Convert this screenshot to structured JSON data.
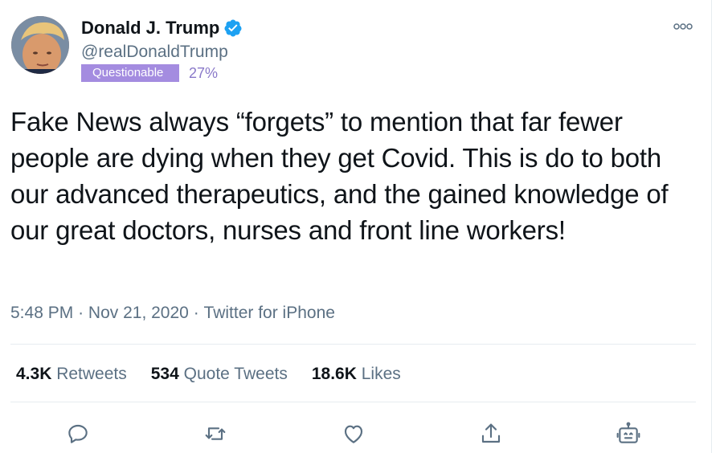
{
  "user": {
    "display_name": "Donald J. Trump",
    "handle": "@realDonaldTrump",
    "verified": true
  },
  "rating": {
    "label": "Questionable",
    "percent": "27%"
  },
  "tweet": {
    "text": "Fake News always “forgets” to mention that far fewer people are dying when they get Covid. This is do to both our advanced therapeutics, and the gained knowledge of our great doctors, nurses and front line workers!",
    "time": "5:48 PM",
    "date": "Nov 21, 2020",
    "source": "Twitter for iPhone",
    "dot": "·"
  },
  "stats": {
    "retweets_count": "4.3K",
    "retweets_label": "Retweets",
    "quotes_count": "534",
    "quotes_label": "Quote Tweets",
    "likes_count": "18.6K",
    "likes_label": "Likes"
  },
  "icons": {
    "reply": "reply-icon",
    "retweet": "retweet-icon",
    "like": "heart-icon",
    "share": "share-icon",
    "bot": "bot-icon",
    "more": "more-icon",
    "verified": "verified-badge-icon"
  },
  "colors": {
    "text": "#0f1419",
    "secondary": "#5b7083",
    "verified": "#1da1f2",
    "badge": "#a48ce0",
    "percent": "#8a79c9"
  }
}
